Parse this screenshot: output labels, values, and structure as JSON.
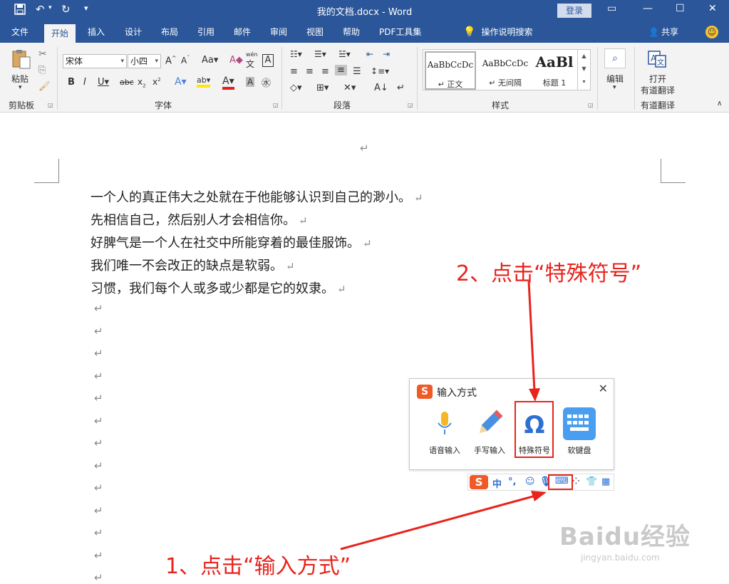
{
  "window": {
    "title": "我的文档.docx  -  Word",
    "login": "登录"
  },
  "tabs": [
    "文件",
    "开始",
    "插入",
    "设计",
    "布局",
    "引用",
    "邮件",
    "审阅",
    "视图",
    "帮助",
    "PDF工具集"
  ],
  "active_tab": "开始",
  "tell_me": "操作说明搜索",
  "share": "共享",
  "ribbon": {
    "clipboard": {
      "label": "剪贴板",
      "paste": "粘贴"
    },
    "font": {
      "label": "字体",
      "font_name": "宋体",
      "font_size": "小四",
      "wen": "wén",
      "wen_char": "文"
    },
    "paragraph": {
      "label": "段落"
    },
    "styles": {
      "label": "样式",
      "items": [
        {
          "sample": "AaBbCcDc",
          "name": "↵ 正文"
        },
        {
          "sample": "AaBbCcDc",
          "name": "↵ 无间隔"
        },
        {
          "sample": "AaBl",
          "name": "标题 1"
        }
      ]
    },
    "editing": {
      "label": "编辑"
    },
    "youdao": {
      "line1": "打开",
      "line2": "有道翻译",
      "label": "有道翻译"
    }
  },
  "document": {
    "lines": [
      "一个人的真正伟大之处就在于他能够认识到自己的渺小。",
      "先相信自己，然后别人才会相信你。",
      "好脾气是一个人在社交中所能穿着的最佳服饰。",
      "我们唯一不会改正的缺点是软弱。",
      "习惯，我们每个人或多或少都是它的奴隶。"
    ],
    "para_mark": "↵"
  },
  "ime_popup": {
    "title": "输入方式",
    "items": [
      "语音输入",
      "手写输入",
      "特殊符号",
      "软键盘"
    ]
  },
  "ime_bar": {
    "zhong": "中",
    "punct": "°,"
  },
  "annotations": {
    "step1": "1、点击“输入方式”",
    "step2": "2、点击“特殊符号”"
  },
  "watermark": {
    "main": "Baidu经验",
    "sub": "jingyan.baidu.com"
  },
  "colors": {
    "word_blue": "#2b579a",
    "annotation_red": "#e8231c",
    "sogou_orange": "#f05a28"
  }
}
